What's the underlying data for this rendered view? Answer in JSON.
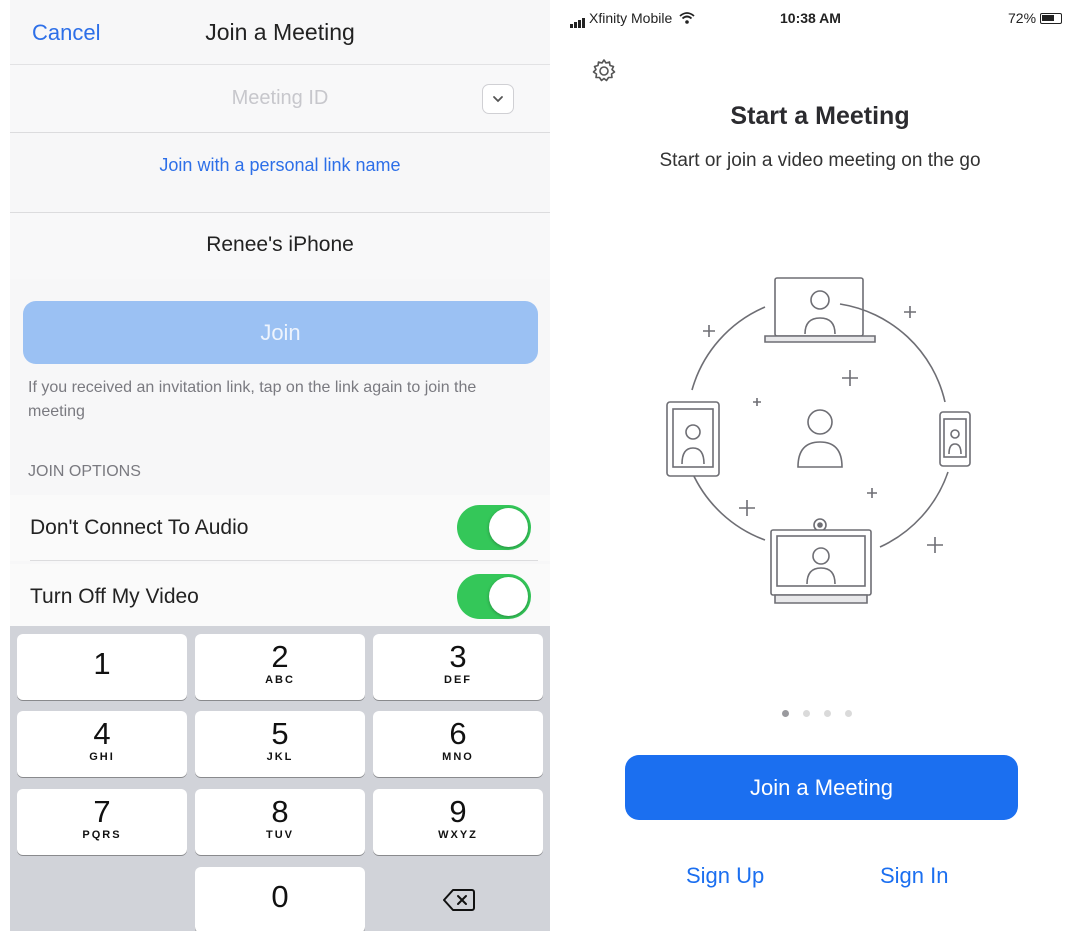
{
  "left": {
    "nav": {
      "cancel": "Cancel",
      "title": "Join a Meeting"
    },
    "meeting_id": {
      "placeholder": "Meeting ID",
      "dropdown_icon": "chevron-down-icon"
    },
    "personal_link": "Join with a personal link name",
    "display_name": "Renee's iPhone",
    "join_button": "Join",
    "hint": "If you received an invitation link, tap on the link again to join the meeting",
    "options_header": "JOIN OPTIONS",
    "options": [
      {
        "label": "Don't Connect To Audio",
        "on": true
      },
      {
        "label": "Turn Off My Video",
        "on": true
      }
    ],
    "toggle_color": "#34c759",
    "keypad": {
      "keys": [
        {
          "num": "1",
          "letters": ""
        },
        {
          "num": "2",
          "letters": "ABC"
        },
        {
          "num": "3",
          "letters": "DEF"
        },
        {
          "num": "4",
          "letters": "GHI"
        },
        {
          "num": "5",
          "letters": "JKL"
        },
        {
          "num": "6",
          "letters": "MNO"
        },
        {
          "num": "7",
          "letters": "PQRS"
        },
        {
          "num": "8",
          "letters": "TUV"
        },
        {
          "num": "9",
          "letters": "WXYZ"
        },
        {
          "num": "0",
          "letters": ""
        }
      ],
      "delete_icon": "backspace-icon"
    }
  },
  "right": {
    "status": {
      "carrier": "Xfinity Mobile",
      "time": "10:38 AM",
      "battery": "72%",
      "battery_level": 0.72
    },
    "settings_icon": "gear-icon",
    "title": "Start a Meeting",
    "subtitle": "Start or join a video meeting on the go",
    "illustration": "devices-connected-illustration",
    "page_dots": {
      "count": 4,
      "active": 0
    },
    "join_button": "Join a Meeting",
    "sign_up": "Sign Up",
    "sign_in": "Sign In",
    "accent_color": "#1b6ff0"
  }
}
